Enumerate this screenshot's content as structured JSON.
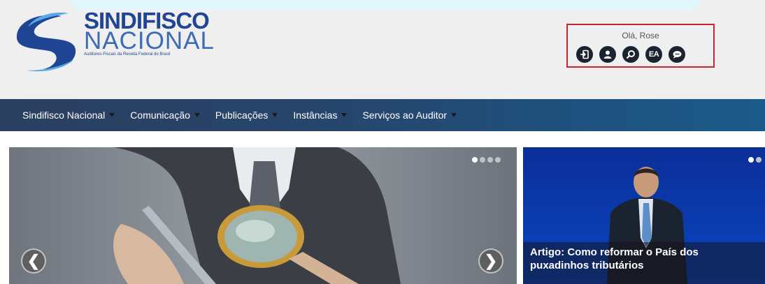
{
  "logo": {
    "line1": "SINDIFISCO",
    "line2": "NACIONAL",
    "line3": "Auditores-Fiscais da Receita Federal do Brasil"
  },
  "user": {
    "greeting": "Olá, Rose",
    "icons": [
      "logout-icon",
      "profile-icon",
      "search-icon",
      "ea-icon",
      "chat-icon"
    ],
    "ea_label": "EA"
  },
  "nav": {
    "items": [
      {
        "label": "Sindifisco Nacional"
      },
      {
        "label": "Comunicação"
      },
      {
        "label": "Publicações"
      },
      {
        "label": "Instâncias"
      },
      {
        "label": "Serviços ao Auditor"
      }
    ]
  },
  "slider_main": {
    "prev": "❮",
    "next": "❯",
    "active_index": 0,
    "slide_count": 4
  },
  "slider_side": {
    "caption": "Artigo: Como reformar o País dos puxadinhos tributários",
    "active_index": 0,
    "slide_count": 2
  },
  "colors": {
    "brand_blue": "#1f4594",
    "highlight_red": "#d0202e",
    "nav_dark": "#27466d"
  }
}
